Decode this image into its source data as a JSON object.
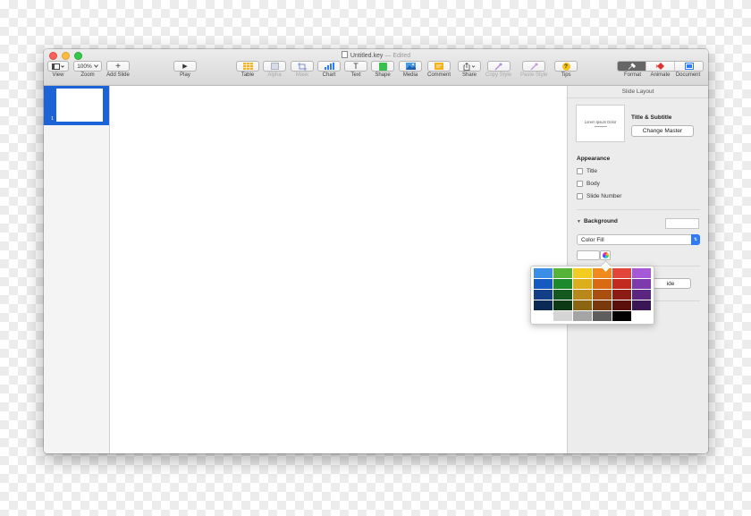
{
  "window": {
    "file_name": "Untitled.key",
    "separator": "—",
    "status": "Edited"
  },
  "toolbar": {
    "view_label": "View",
    "zoom_value": "100%",
    "zoom_label": "Zoom",
    "add_slide_label": "Add Slide",
    "play_label": "Play",
    "table_label": "Table",
    "alpha_label": "Alpha",
    "mask_label": "Mask",
    "chart_label": "Chart",
    "text_label": "Text",
    "shape_label": "Shape",
    "media_label": "Media",
    "comment_label": "Comment",
    "share_label": "Share",
    "copy_style_label": "Copy Style",
    "paste_style_label": "Paste Style",
    "tips_label": "Tips",
    "tips_glyph": "?",
    "text_glyph": "T",
    "add_glyph": "+",
    "play_glyph": "▶",
    "format_label": "Format",
    "animate_label": "Animate",
    "document_label": "Document"
  },
  "navigator": {
    "slides": [
      {
        "number": "1"
      }
    ]
  },
  "inspector": {
    "title": "Slide Layout",
    "master_thumb_text": "Lorem Ipsum Dolor",
    "master_name": "Title & Subtitle",
    "change_master_label": "Change Master",
    "appearance_heading": "Appearance",
    "checkboxes": [
      {
        "label": "Title",
        "checked": false
      },
      {
        "label": "Body",
        "checked": false
      },
      {
        "label": "Slide Number",
        "checked": false
      }
    ],
    "background_heading": "Background",
    "fill_type": "Color Fill",
    "partial_button_label": "ide"
  },
  "palette": {
    "rows": [
      [
        "#3a8ee6",
        "#55b337",
        "#f2cc1e",
        "#f08a1c",
        "#e2463a",
        "#a659d6"
      ],
      [
        "#1659c0",
        "#1c8a2c",
        "#dcae1b",
        "#d86a14",
        "#c22a1f",
        "#7d3aad"
      ],
      [
        "#123f86",
        "#145a20",
        "#b8891a",
        "#a94f12",
        "#8b1b14",
        "#5a2680"
      ],
      [
        "#0b2955",
        "#0c3814",
        "#8a6512",
        "#7a380d",
        "#5a0f0c",
        "#3a1654"
      ],
      [
        "#ffffff",
        "#d5d5d5",
        "#a5a5a5",
        "#5e5e5e",
        "#000000",
        "#ffffff"
      ]
    ]
  },
  "colors": {
    "selection_blue": "#1d63d8",
    "accent_blue": "#2f7bf5"
  }
}
